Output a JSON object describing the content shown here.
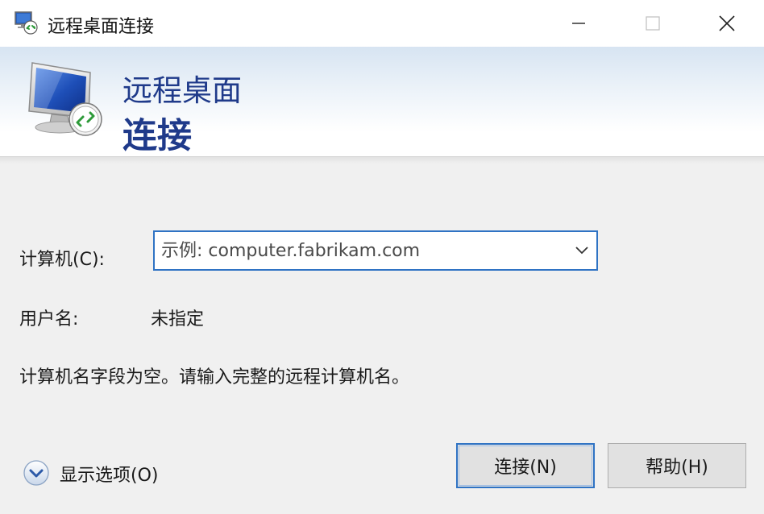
{
  "window": {
    "title": "远程桌面连接"
  },
  "banner": {
    "line1": "远程桌面",
    "line2": "连接"
  },
  "form": {
    "computer_label": "计算机(C):",
    "computer_placeholder": "示例: computer.fabrikam.com",
    "computer_value": "",
    "username_label": "用户名:",
    "username_value": "未指定",
    "message": "计算机名字段为空。请输入完整的远程计算机名。"
  },
  "footer": {
    "show_options_label": "显示选项(O)",
    "connect_label": "连接(N)",
    "help_label": "帮助(H)"
  },
  "colors": {
    "accent": "#2f73c4",
    "banner_text": "#1f3a8a",
    "background": "#f0f0f0"
  },
  "icons": {
    "app": "remote-desktop-icon",
    "banner": "monitor-connect-icon",
    "minimize": "minimize-icon",
    "maximize": "maximize-icon",
    "close": "close-icon",
    "dropdown": "chevron-down-icon",
    "options": "expand-circle-icon"
  }
}
